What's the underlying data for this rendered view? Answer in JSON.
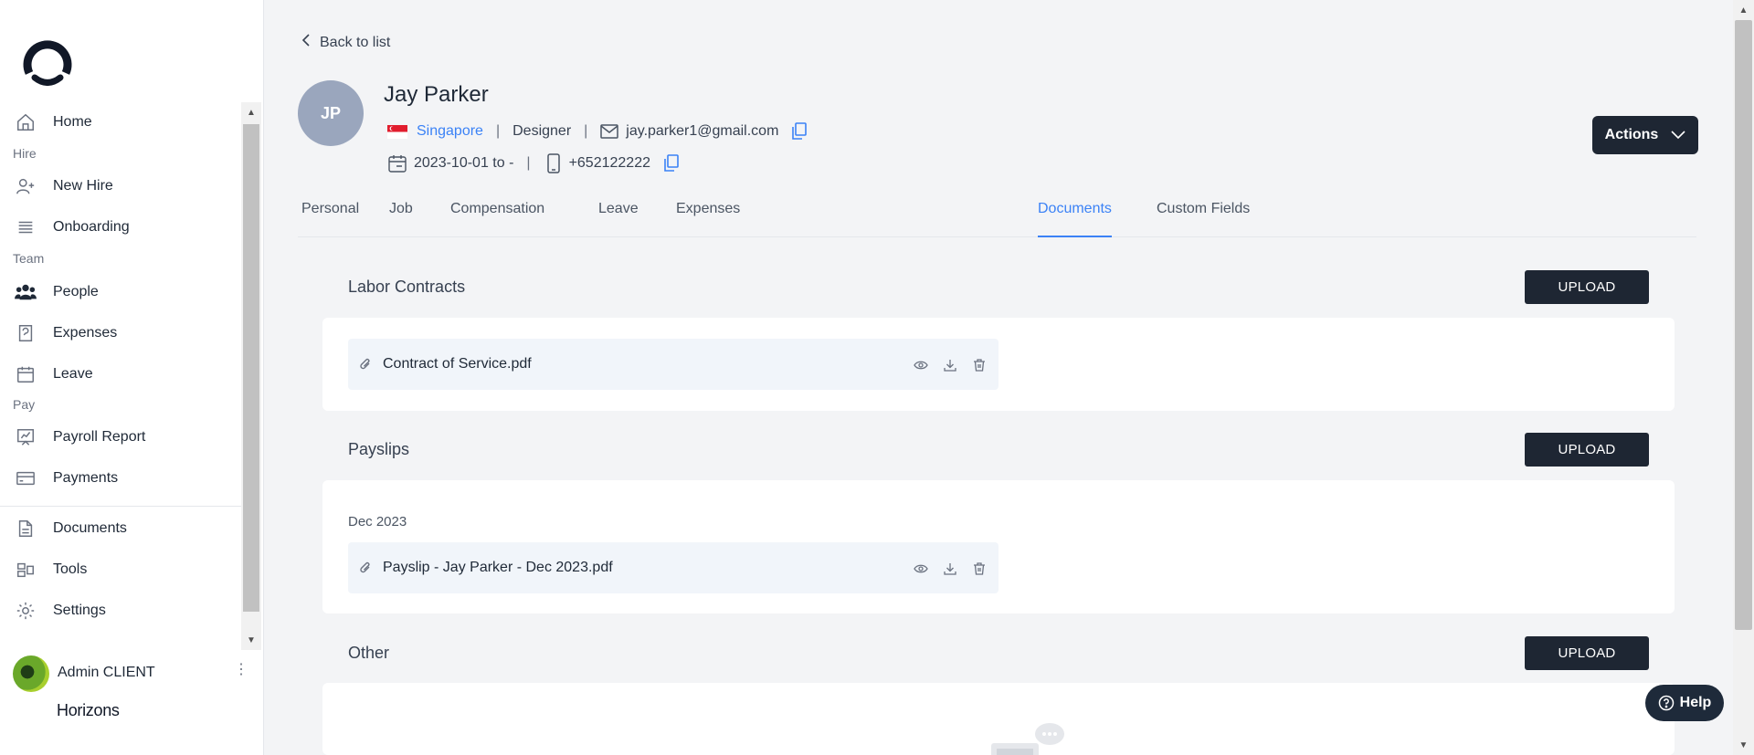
{
  "sidebar": {
    "nav": {
      "home": "Home",
      "hire_section": "Hire",
      "new_hire": "New Hire",
      "onboarding": "Onboarding",
      "team_section": "Team",
      "people": "People",
      "expenses": "Expenses",
      "leave": "Leave",
      "pay_section": "Pay",
      "payroll_report": "Payroll Report",
      "payments": "Payments",
      "documents": "Documents",
      "tools": "Tools",
      "settings": "Settings"
    },
    "user": {
      "name": "Admin CLIENT"
    },
    "brand": "Horizons"
  },
  "header": {
    "back_label": "Back to list",
    "avatar_initials": "JP",
    "name": "Jay Parker",
    "country": "Singapore",
    "role": "Designer",
    "email": "jay.parker1@gmail.com",
    "date_range": "2023-10-01 to -",
    "phone": "+652122222",
    "actions_label": "Actions"
  },
  "tabs": [
    {
      "label": "Personal"
    },
    {
      "label": "Job"
    },
    {
      "label": "Compensation"
    },
    {
      "label": "Leave"
    },
    {
      "label": "Expenses"
    },
    {
      "label": "Documents",
      "active": true
    },
    {
      "label": "Custom Fields"
    }
  ],
  "sections": {
    "labor": {
      "title": "Labor Contracts",
      "upload_label": "UPLOAD",
      "files": [
        {
          "name": "Contract of Service.pdf"
        }
      ]
    },
    "payslips": {
      "title": "Payslips",
      "upload_label": "UPLOAD",
      "month": "Dec 2023",
      "files": [
        {
          "name": "Payslip - Jay Parker - Dec 2023.pdf"
        }
      ]
    },
    "other": {
      "title": "Other",
      "upload_label": "UPLOAD"
    }
  },
  "help_label": "Help",
  "colors": {
    "accent": "#3b82f6",
    "dark_button": "#1e2633",
    "avatar": "#9aa6bd"
  }
}
